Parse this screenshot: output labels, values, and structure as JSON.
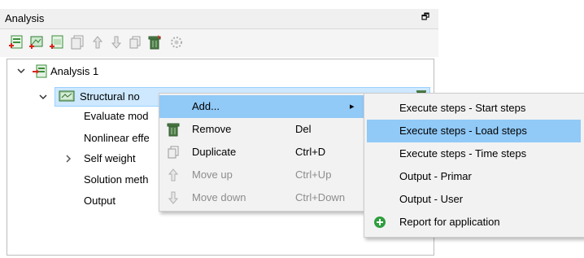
{
  "panel": {
    "title": "Analysis",
    "float_glyph": "🗗"
  },
  "toolbar": {
    "icons": [
      "add-analysis-icon",
      "add-structural-analysis-icon",
      "add-step-icon",
      "copy-analysis-icon",
      "move-up-icon",
      "move-down-icon",
      "duplicate-icon",
      "delete-icon",
      "settings-icon"
    ]
  },
  "tree": {
    "analysis": "Analysis 1",
    "structural": "Structural no",
    "children": [
      "Evaluate mod",
      "Nonlinear effe",
      "Self weight",
      "Solution meth",
      "Output"
    ]
  },
  "context_menu": {
    "items": [
      {
        "label": "Add...",
        "shortcut": "",
        "disabled": false,
        "highlight": true,
        "submenu_arrow": "▸"
      },
      {
        "label": "Remove",
        "shortcut": "Del",
        "disabled": false,
        "highlight": false
      },
      {
        "label": "Duplicate",
        "shortcut": "Ctrl+D",
        "disabled": false,
        "highlight": false
      },
      {
        "label": "Move up",
        "shortcut": "Ctrl+Up",
        "disabled": true,
        "highlight": false
      },
      {
        "label": "Move down",
        "shortcut": "Ctrl+Down",
        "disabled": true,
        "highlight": false
      }
    ]
  },
  "submenu": {
    "items": [
      {
        "label": "Execute steps - Start steps"
      },
      {
        "label": "Execute steps - Load steps"
      },
      {
        "label": "Execute steps - Time steps"
      },
      {
        "label": "Output - Primar"
      },
      {
        "label": "Output - User"
      },
      {
        "label": "Report for application"
      }
    ],
    "highlight_index": 1
  },
  "colors": {
    "selection": "#cde8ff",
    "menu_highlight": "#91c9f7",
    "accent_red": "#d9241c",
    "accent_green": "#2e9e3e"
  }
}
